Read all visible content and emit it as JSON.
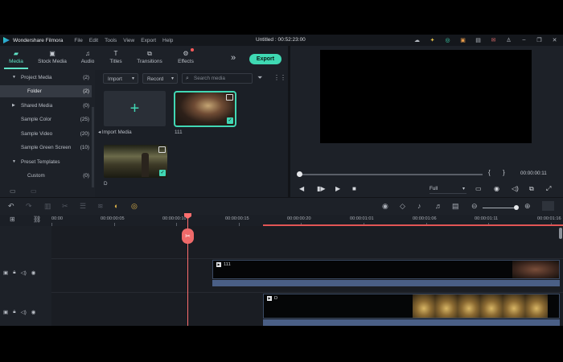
{
  "app": {
    "name": "Wondershare Filmora",
    "title": "Untitled : 00:52:23:00"
  },
  "menu": [
    "File",
    "Edit",
    "Tools",
    "View",
    "Export",
    "Help"
  ],
  "tabs": [
    {
      "label": "Media",
      "icon": "folder-icon"
    },
    {
      "label": "Stock Media",
      "icon": "stock-media-icon"
    },
    {
      "label": "Audio",
      "icon": "music-note-icon"
    },
    {
      "label": "Titles",
      "icon": "text-icon"
    },
    {
      "label": "Transitions",
      "icon": "transitions-icon"
    },
    {
      "label": "Effects",
      "icon": "effects-icon"
    }
  ],
  "export_label": "Export",
  "sidebar": {
    "items": [
      {
        "label": "Project Media",
        "count": "(2)"
      },
      {
        "label": "Folder",
        "count": "(2)"
      },
      {
        "label": "Shared Media",
        "count": "(0)"
      },
      {
        "label": "Sample Color",
        "count": "(25)"
      },
      {
        "label": "Sample Video",
        "count": "(20)"
      },
      {
        "label": "Sample Green Screen",
        "count": "(10)"
      },
      {
        "label": "Preset Templates",
        "count": ""
      },
      {
        "label": "Custom",
        "count": "(0)"
      }
    ]
  },
  "media": {
    "import_label": "Import",
    "record_label": "Record",
    "search_placeholder": "Search media",
    "import_media_label": "Import Media",
    "items": [
      {
        "name": "111"
      },
      {
        "name": "D"
      }
    ]
  },
  "preview": {
    "timecode": "00:00:00:11",
    "quality": "Full"
  },
  "ruler": [
    "00:00",
    "00:00:00:05",
    "00:00:00:10",
    "00:00:00:15",
    "00:00:00:20",
    "00:00:01:01",
    "00:00:01:06",
    "00:00:01:11",
    "00:00:01:16"
  ],
  "timeline": {
    "clips": [
      {
        "name": "111"
      },
      {
        "name": "D"
      }
    ]
  }
}
